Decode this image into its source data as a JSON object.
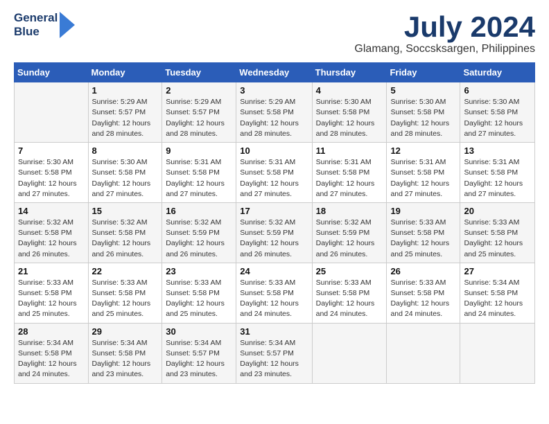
{
  "header": {
    "logo_line1": "General",
    "logo_line2": "Blue",
    "title": "July 2024",
    "subtitle": "Glamang, Soccsksargen, Philippines"
  },
  "weekdays": [
    "Sunday",
    "Monday",
    "Tuesday",
    "Wednesday",
    "Thursday",
    "Friday",
    "Saturday"
  ],
  "weeks": [
    [
      {
        "day": "",
        "sunrise": "",
        "sunset": "",
        "daylight": ""
      },
      {
        "day": "1",
        "sunrise": "Sunrise: 5:29 AM",
        "sunset": "Sunset: 5:57 PM",
        "daylight": "Daylight: 12 hours and 28 minutes."
      },
      {
        "day": "2",
        "sunrise": "Sunrise: 5:29 AM",
        "sunset": "Sunset: 5:57 PM",
        "daylight": "Daylight: 12 hours and 28 minutes."
      },
      {
        "day": "3",
        "sunrise": "Sunrise: 5:29 AM",
        "sunset": "Sunset: 5:58 PM",
        "daylight": "Daylight: 12 hours and 28 minutes."
      },
      {
        "day": "4",
        "sunrise": "Sunrise: 5:30 AM",
        "sunset": "Sunset: 5:58 PM",
        "daylight": "Daylight: 12 hours and 28 minutes."
      },
      {
        "day": "5",
        "sunrise": "Sunrise: 5:30 AM",
        "sunset": "Sunset: 5:58 PM",
        "daylight": "Daylight: 12 hours and 28 minutes."
      },
      {
        "day": "6",
        "sunrise": "Sunrise: 5:30 AM",
        "sunset": "Sunset: 5:58 PM",
        "daylight": "Daylight: 12 hours and 27 minutes."
      }
    ],
    [
      {
        "day": "7",
        "sunrise": "Sunrise: 5:30 AM",
        "sunset": "Sunset: 5:58 PM",
        "daylight": "Daylight: 12 hours and 27 minutes."
      },
      {
        "day": "8",
        "sunrise": "Sunrise: 5:30 AM",
        "sunset": "Sunset: 5:58 PM",
        "daylight": "Daylight: 12 hours and 27 minutes."
      },
      {
        "day": "9",
        "sunrise": "Sunrise: 5:31 AM",
        "sunset": "Sunset: 5:58 PM",
        "daylight": "Daylight: 12 hours and 27 minutes."
      },
      {
        "day": "10",
        "sunrise": "Sunrise: 5:31 AM",
        "sunset": "Sunset: 5:58 PM",
        "daylight": "Daylight: 12 hours and 27 minutes."
      },
      {
        "day": "11",
        "sunrise": "Sunrise: 5:31 AM",
        "sunset": "Sunset: 5:58 PM",
        "daylight": "Daylight: 12 hours and 27 minutes."
      },
      {
        "day": "12",
        "sunrise": "Sunrise: 5:31 AM",
        "sunset": "Sunset: 5:58 PM",
        "daylight": "Daylight: 12 hours and 27 minutes."
      },
      {
        "day": "13",
        "sunrise": "Sunrise: 5:31 AM",
        "sunset": "Sunset: 5:58 PM",
        "daylight": "Daylight: 12 hours and 27 minutes."
      }
    ],
    [
      {
        "day": "14",
        "sunrise": "Sunrise: 5:32 AM",
        "sunset": "Sunset: 5:58 PM",
        "daylight": "Daylight: 12 hours and 26 minutes."
      },
      {
        "day": "15",
        "sunrise": "Sunrise: 5:32 AM",
        "sunset": "Sunset: 5:58 PM",
        "daylight": "Daylight: 12 hours and 26 minutes."
      },
      {
        "day": "16",
        "sunrise": "Sunrise: 5:32 AM",
        "sunset": "Sunset: 5:59 PM",
        "daylight": "Daylight: 12 hours and 26 minutes."
      },
      {
        "day": "17",
        "sunrise": "Sunrise: 5:32 AM",
        "sunset": "Sunset: 5:59 PM",
        "daylight": "Daylight: 12 hours and 26 minutes."
      },
      {
        "day": "18",
        "sunrise": "Sunrise: 5:32 AM",
        "sunset": "Sunset: 5:59 PM",
        "daylight": "Daylight: 12 hours and 26 minutes."
      },
      {
        "day": "19",
        "sunrise": "Sunrise: 5:33 AM",
        "sunset": "Sunset: 5:58 PM",
        "daylight": "Daylight: 12 hours and 25 minutes."
      },
      {
        "day": "20",
        "sunrise": "Sunrise: 5:33 AM",
        "sunset": "Sunset: 5:58 PM",
        "daylight": "Daylight: 12 hours and 25 minutes."
      }
    ],
    [
      {
        "day": "21",
        "sunrise": "Sunrise: 5:33 AM",
        "sunset": "Sunset: 5:58 PM",
        "daylight": "Daylight: 12 hours and 25 minutes."
      },
      {
        "day": "22",
        "sunrise": "Sunrise: 5:33 AM",
        "sunset": "Sunset: 5:58 PM",
        "daylight": "Daylight: 12 hours and 25 minutes."
      },
      {
        "day": "23",
        "sunrise": "Sunrise: 5:33 AM",
        "sunset": "Sunset: 5:58 PM",
        "daylight": "Daylight: 12 hours and 25 minutes."
      },
      {
        "day": "24",
        "sunrise": "Sunrise: 5:33 AM",
        "sunset": "Sunset: 5:58 PM",
        "daylight": "Daylight: 12 hours and 24 minutes."
      },
      {
        "day": "25",
        "sunrise": "Sunrise: 5:33 AM",
        "sunset": "Sunset: 5:58 PM",
        "daylight": "Daylight: 12 hours and 24 minutes."
      },
      {
        "day": "26",
        "sunrise": "Sunrise: 5:33 AM",
        "sunset": "Sunset: 5:58 PM",
        "daylight": "Daylight: 12 hours and 24 minutes."
      },
      {
        "day": "27",
        "sunrise": "Sunrise: 5:34 AM",
        "sunset": "Sunset: 5:58 PM",
        "daylight": "Daylight: 12 hours and 24 minutes."
      }
    ],
    [
      {
        "day": "28",
        "sunrise": "Sunrise: 5:34 AM",
        "sunset": "Sunset: 5:58 PM",
        "daylight": "Daylight: 12 hours and 24 minutes."
      },
      {
        "day": "29",
        "sunrise": "Sunrise: 5:34 AM",
        "sunset": "Sunset: 5:58 PM",
        "daylight": "Daylight: 12 hours and 23 minutes."
      },
      {
        "day": "30",
        "sunrise": "Sunrise: 5:34 AM",
        "sunset": "Sunset: 5:57 PM",
        "daylight": "Daylight: 12 hours and 23 minutes."
      },
      {
        "day": "31",
        "sunrise": "Sunrise: 5:34 AM",
        "sunset": "Sunset: 5:57 PM",
        "daylight": "Daylight: 12 hours and 23 minutes."
      },
      {
        "day": "",
        "sunrise": "",
        "sunset": "",
        "daylight": ""
      },
      {
        "day": "",
        "sunrise": "",
        "sunset": "",
        "daylight": ""
      },
      {
        "day": "",
        "sunrise": "",
        "sunset": "",
        "daylight": ""
      }
    ]
  ]
}
